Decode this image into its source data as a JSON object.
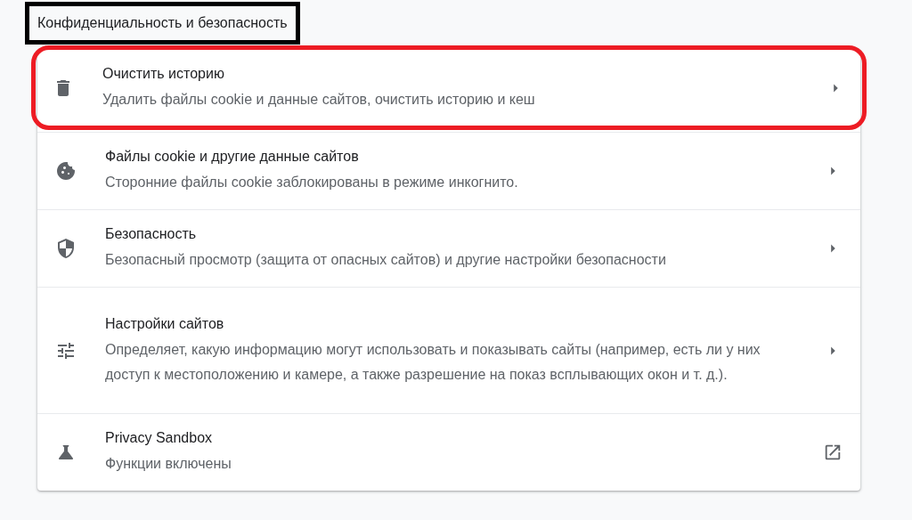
{
  "section": {
    "title": "Конфиденциальность и безопасность",
    "outlined": true
  },
  "items": [
    {
      "title": "Очистить историю",
      "subtitle": "Удалить файлы cookie и данные сайтов, очистить историю и кеш",
      "kind": "submenu",
      "highlighted": true
    },
    {
      "title": "Файлы cookie и другие данные сайтов",
      "subtitle": "Сторонние файлы cookie заблокированы в режиме инкогнито.",
      "kind": "submenu",
      "highlighted": false
    },
    {
      "title": "Безопасность",
      "subtitle": "Безопасный просмотр (защита от опасных сайтов) и другие настройки безопасности",
      "kind": "submenu",
      "highlighted": false
    },
    {
      "title": "Настройки сайтов",
      "subtitle": "Определяет, какую информацию могут использовать и показывать сайты (например, есть ли у них доступ к местоположению и камере, а также разрешение на показ всплывающих окон и т. д.).",
      "kind": "submenu",
      "highlighted": false
    },
    {
      "title": "Privacy Sandbox",
      "subtitle": "Функции включены",
      "kind": "external",
      "highlighted": false
    }
  ]
}
